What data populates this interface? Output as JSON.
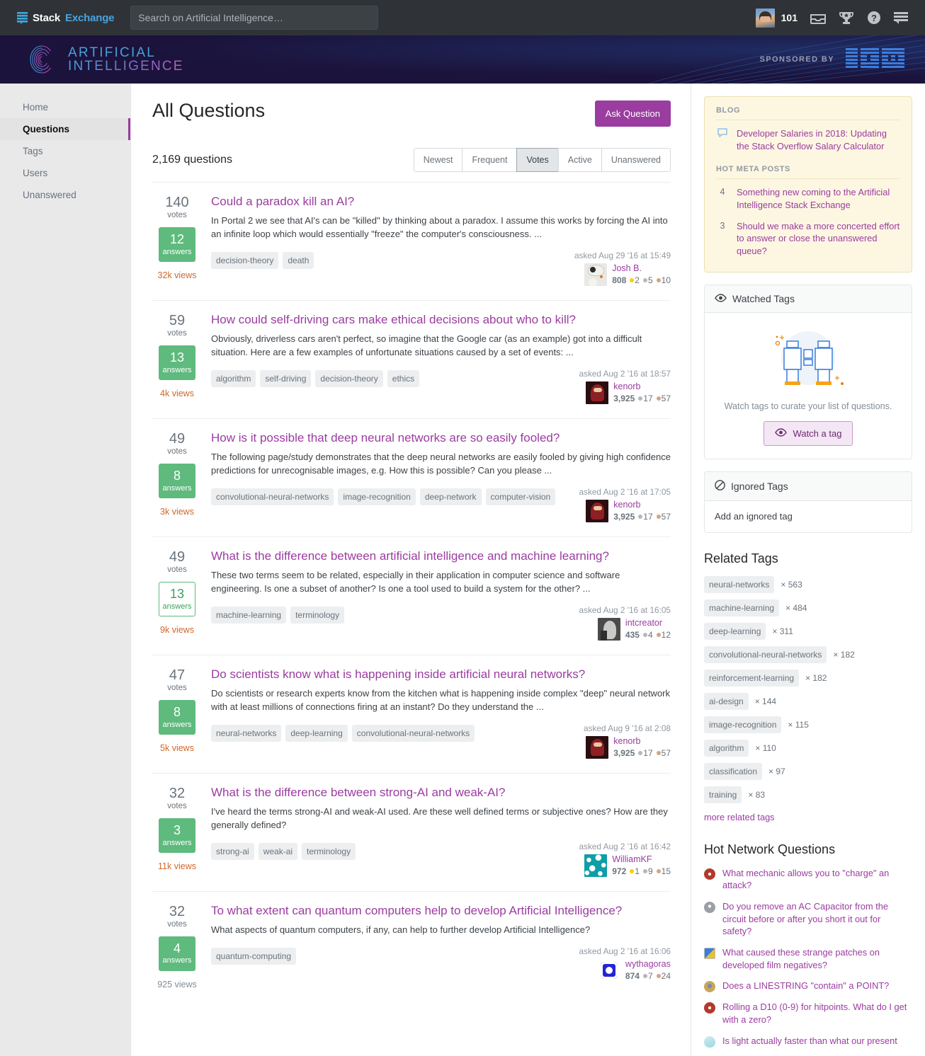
{
  "topbar": {
    "brand_stack": "Stack",
    "brand_exchange": "Exchange",
    "search_placeholder": "Search on Artificial Intelligence…",
    "search_value": "",
    "reputation": "101",
    "icons": [
      "inbox-icon",
      "trophy-icon",
      "help-icon",
      "site-switcher-icon"
    ]
  },
  "sitebar": {
    "logo_line1": "ARTIFICIAL",
    "logo_line2": "INTELLIGENCE",
    "sponsor_label": "SPONSORED BY",
    "sponsor_name": "IBM"
  },
  "sidebar_nav": {
    "items": [
      {
        "label": "Home",
        "active": false
      },
      {
        "label": "Questions",
        "active": true
      },
      {
        "label": "Tags",
        "active": false
      },
      {
        "label": "Users",
        "active": false
      },
      {
        "label": "Unanswered",
        "active": false
      }
    ]
  },
  "main": {
    "title": "All Questions",
    "ask_button": "Ask Question",
    "question_count": "2,169 questions",
    "tabs": [
      {
        "label": "Newest",
        "selected": false
      },
      {
        "label": "Frequent",
        "selected": false
      },
      {
        "label": "Votes",
        "selected": true
      },
      {
        "label": "Active",
        "selected": false
      },
      {
        "label": "Unanswered",
        "selected": false
      }
    ],
    "votes_label": "votes",
    "answers_label": "answers",
    "questions": [
      {
        "votes": "140",
        "answers": "12",
        "answers_style": "filled",
        "views": "32k views",
        "views_hot": true,
        "title": "Could a paradox kill an AI?",
        "excerpt": "In Portal 2 we see that AI's can be \"killed\" by thinking about a paradox. I assume this works by forcing the AI into an infinite loop which would essentially \"freeze\" the computer's consciousness. ...",
        "tags": [
          "decision-theory",
          "death"
        ],
        "asked": "asked Aug 29 '16 at 15:49",
        "user": "Josh B.",
        "rep": "808",
        "gold": "2",
        "silver": "5",
        "bronze": "10",
        "avatar": "av-bb8"
      },
      {
        "votes": "59",
        "answers": "13",
        "answers_style": "filled",
        "views": "4k views",
        "views_hot": true,
        "title": "How could self-driving cars make ethical decisions about who to kill?",
        "excerpt": "Obviously, driverless cars aren't perfect, so imagine that the Google car (as an example) got into a difficult situation. Here are a few examples of unfortunate situations caused by a set of events: ...",
        "tags": [
          "algorithm",
          "self-driving",
          "decision-theory",
          "ethics"
        ],
        "asked": "asked Aug 2 '16 at 18:57",
        "user": "kenorb",
        "rep": "3,925",
        "gold": "",
        "silver": "17",
        "bronze": "57",
        "avatar": "av-kenorb"
      },
      {
        "votes": "49",
        "answers": "8",
        "answers_style": "filled",
        "views": "3k views",
        "views_hot": true,
        "title": "How is it possible that deep neural networks are so easily fooled?",
        "excerpt": "The following page/study demonstrates that the deep neural networks are easily fooled by giving high confidence predictions for unrecognisable images, e.g. How this is possible? Can you please ...",
        "tags": [
          "convolutional-neural-networks",
          "image-recognition",
          "deep-network",
          "computer-vision"
        ],
        "asked": "asked Aug 2 '16 at 17:05",
        "user": "kenorb",
        "rep": "3,925",
        "gold": "",
        "silver": "17",
        "bronze": "57",
        "avatar": "av-kenorb"
      },
      {
        "votes": "49",
        "answers": "13",
        "answers_style": "outline",
        "views": "9k views",
        "views_hot": true,
        "title": "What is the difference between artificial intelligence and machine learning?",
        "excerpt": "These two terms seem to be related, especially in their application in computer science and software engineering. Is one a subset of another? Is one a tool used to build a system for the other? ...",
        "tags": [
          "machine-learning",
          "terminology"
        ],
        "asked": "asked Aug 2 '16 at 16:05",
        "user": "intcreator",
        "rep": "435",
        "gold": "",
        "silver": "4",
        "bronze": "12",
        "avatar": "av-int"
      },
      {
        "votes": "47",
        "answers": "8",
        "answers_style": "filled",
        "views": "5k views",
        "views_hot": true,
        "title": "Do scientists know what is happening inside artificial neural networks?",
        "excerpt": "Do scientists or research experts know from the kitchen what is happening inside complex \"deep\" neural network with at least millions of connections firing at an instant? Do they understand the ...",
        "tags": [
          "neural-networks",
          "deep-learning",
          "convolutional-neural-networks"
        ],
        "asked": "asked Aug 9 '16 at 2:08",
        "user": "kenorb",
        "rep": "3,925",
        "gold": "",
        "silver": "17",
        "bronze": "57",
        "avatar": "av-kenorb"
      },
      {
        "votes": "32",
        "answers": "3",
        "answers_style": "filled",
        "views": "11k views",
        "views_hot": true,
        "title": "What is the difference between strong-AI and weak-AI?",
        "excerpt": "I've heard the terms strong-AI and weak-AI used. Are these well defined terms or subjective ones? How are they generally defined?",
        "tags": [
          "strong-ai",
          "weak-ai",
          "terminology"
        ],
        "asked": "asked Aug 2 '16 at 16:42",
        "user": "WilliamKF",
        "rep": "972",
        "gold": "1",
        "silver": "9",
        "bronze": "15",
        "avatar": "av-will"
      },
      {
        "votes": "32",
        "answers": "4",
        "answers_style": "filled",
        "views": "925 views",
        "views_hot": false,
        "title": "To what extent can quantum computers help to develop Artificial Intelligence?",
        "excerpt": "What aspects of quantum computers, if any, can help to further develop Artificial Intelligence?",
        "tags": [
          "quantum-computing"
        ],
        "asked": "asked Aug 2 '16 at 16:06",
        "user": "wythagoras",
        "rep": "874",
        "gold": "",
        "silver": "7",
        "bronze": "24",
        "avatar": "av-wyth"
      }
    ]
  },
  "right": {
    "blog_header": "BLOG",
    "blog_items": [
      {
        "bullet": "speech-bubble-icon",
        "text": "Developer Salaries in 2018: Updating the Stack Overflow Salary Calculator"
      }
    ],
    "meta_header": "HOT META POSTS",
    "meta_items": [
      {
        "bullet": "4",
        "text": "Something new coming to the Artificial Intelligence Stack Exchange"
      },
      {
        "bullet": "3",
        "text": "Should we make a more concerted effort to answer or close the unanswered queue?"
      }
    ],
    "watched_tags": {
      "title": "Watched Tags",
      "empty_text": "Watch tags to curate your list of questions.",
      "button": "Watch a tag"
    },
    "ignored_tags": {
      "title": "Ignored Tags",
      "add_text": "Add an ignored tag"
    },
    "related_tags": {
      "title": "Related Tags",
      "items": [
        {
          "tag": "neural-networks",
          "count": "× 563"
        },
        {
          "tag": "machine-learning",
          "count": "× 484"
        },
        {
          "tag": "deep-learning",
          "count": "× 311"
        },
        {
          "tag": "convolutional-neural-networks",
          "count": "× 182"
        },
        {
          "tag": "reinforcement-learning",
          "count": "× 182"
        },
        {
          "tag": "ai-design",
          "count": "× 144"
        },
        {
          "tag": "image-recognition",
          "count": "× 115"
        },
        {
          "tag": "algorithm",
          "count": "× 110"
        },
        {
          "tag": "classification",
          "count": "× 97"
        },
        {
          "tag": "training",
          "count": "× 83"
        }
      ],
      "more_link": "more related tags"
    },
    "hot_network": {
      "title": "Hot Network Questions",
      "items": [
        {
          "icon": "ic-rpg",
          "text": "What mechanic allows you to \"charge\" an attack?"
        },
        {
          "icon": "ic-elec",
          "text": "Do you remove an AC Capacitor from the circuit before or after you short it out for safety?"
        },
        {
          "icon": "ic-photo",
          "text": "What caused these strange patches on developed film negatives?"
        },
        {
          "icon": "ic-gis",
          "text": "Does a LINESTRING \"contain\" a POINT?"
        },
        {
          "icon": "ic-rpg",
          "text": "Rolling a D10 (0-9) for hitpoints. What do I get with a zero?"
        },
        {
          "icon": "ic-phys",
          "text": "Is light actually faster than what our present"
        }
      ]
    }
  },
  "colors": {
    "accent_purple": "#9b3ca0",
    "answer_green": "#5eba7d",
    "views_orange": "#d1662a",
    "topbar_bg": "#2f3337",
    "sitebar_bg": "#1b133b",
    "blog_bg": "#fdf7e2"
  }
}
